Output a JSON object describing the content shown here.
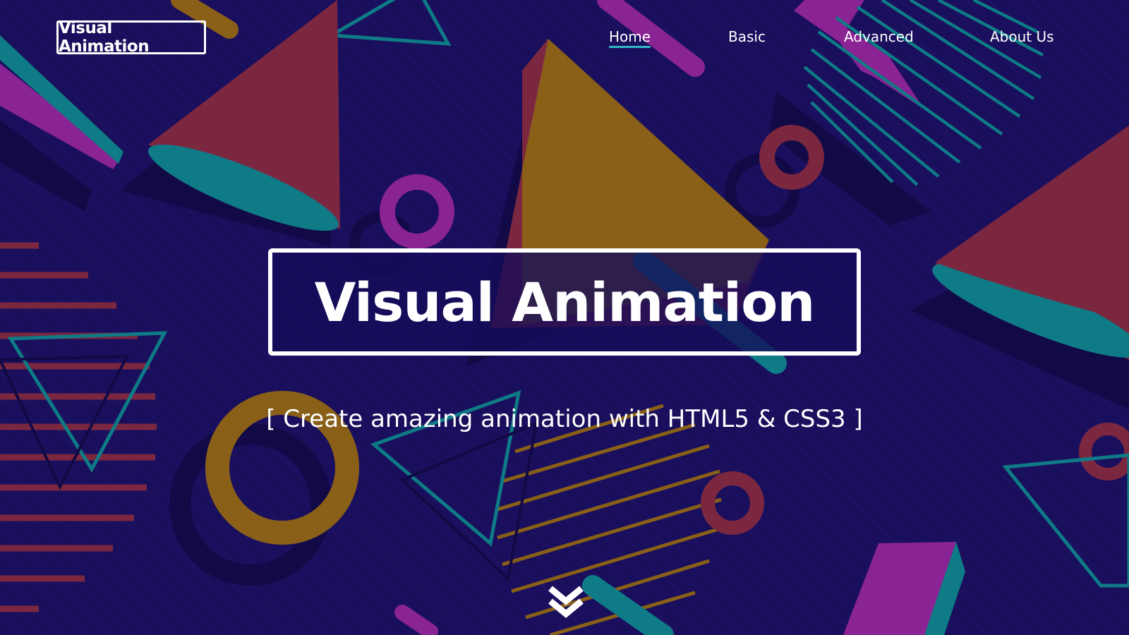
{
  "logo": {
    "text": "Visual Animation"
  },
  "nav": {
    "items": [
      {
        "label": "Home",
        "active": true
      },
      {
        "label": "Basic",
        "active": false
      },
      {
        "label": "Advanced",
        "active": false
      },
      {
        "label": "About Us",
        "active": false
      }
    ]
  },
  "hero": {
    "title": "Visual Animation",
    "tagline": "[ Create amazing animation with HTML5 & CSS3 ]"
  },
  "icons": {
    "scroll": "double-chevron-down-icon"
  },
  "colors": {
    "background": "#1a0f5c",
    "crimson": "#7b2740",
    "teal": "#0e7b86",
    "magenta": "#8a2393",
    "mustard": "#8a6018",
    "accent": "#2fb6c5",
    "white": "#ffffff"
  }
}
